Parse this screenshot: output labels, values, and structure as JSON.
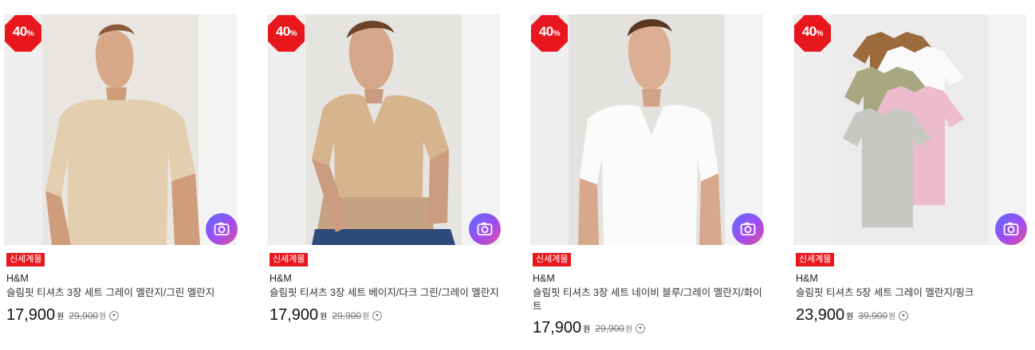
{
  "colors": {
    "badge": "#e8171d",
    "tag": "#e8171d"
  },
  "products": [
    {
      "discount": "40",
      "discount_unit": "%",
      "tag": "신세계몰",
      "brand": "H&M",
      "name": "슬림핏 티셔츠 3장 세트 그레이 멜란지/그린 멜란지",
      "price": "17,900",
      "price_unit": "원",
      "original_price": "29,900",
      "original_unit": "원",
      "image_icon": "shirt-photo-beige-crew",
      "camera_icon": "camera-icon"
    },
    {
      "discount": "40",
      "discount_unit": "%",
      "tag": "신세계몰",
      "brand": "H&M",
      "name": "슬림핏 티셔츠 3장 세트 베이지/다크 그린/그레이 멜란지",
      "price": "17,900",
      "price_unit": "원",
      "original_price": "29,900",
      "original_unit": "원",
      "image_icon": "shirt-photo-beige-vneck",
      "camera_icon": "camera-icon"
    },
    {
      "discount": "40",
      "discount_unit": "%",
      "tag": "신세계몰",
      "brand": "H&M",
      "name": "슬림핏 티셔츠 3장 세트 네이비 블루/그레이 멜란지/화이트",
      "price": "17,900",
      "price_unit": "원",
      "original_price": "29,900",
      "original_unit": "원",
      "image_icon": "shirt-photo-white-vneck",
      "camera_icon": "camera-icon"
    },
    {
      "discount": "40",
      "discount_unit": "%",
      "tag": "신세계몰",
      "brand": "H&M",
      "name": "슬림핏 티셔츠 5장 세트 그레이 멜란지/핑크",
      "price": "23,900",
      "price_unit": "원",
      "original_price": "39,900",
      "original_unit": "원",
      "image_icon": "shirt-photo-stack",
      "camera_icon": "camera-icon"
    }
  ]
}
